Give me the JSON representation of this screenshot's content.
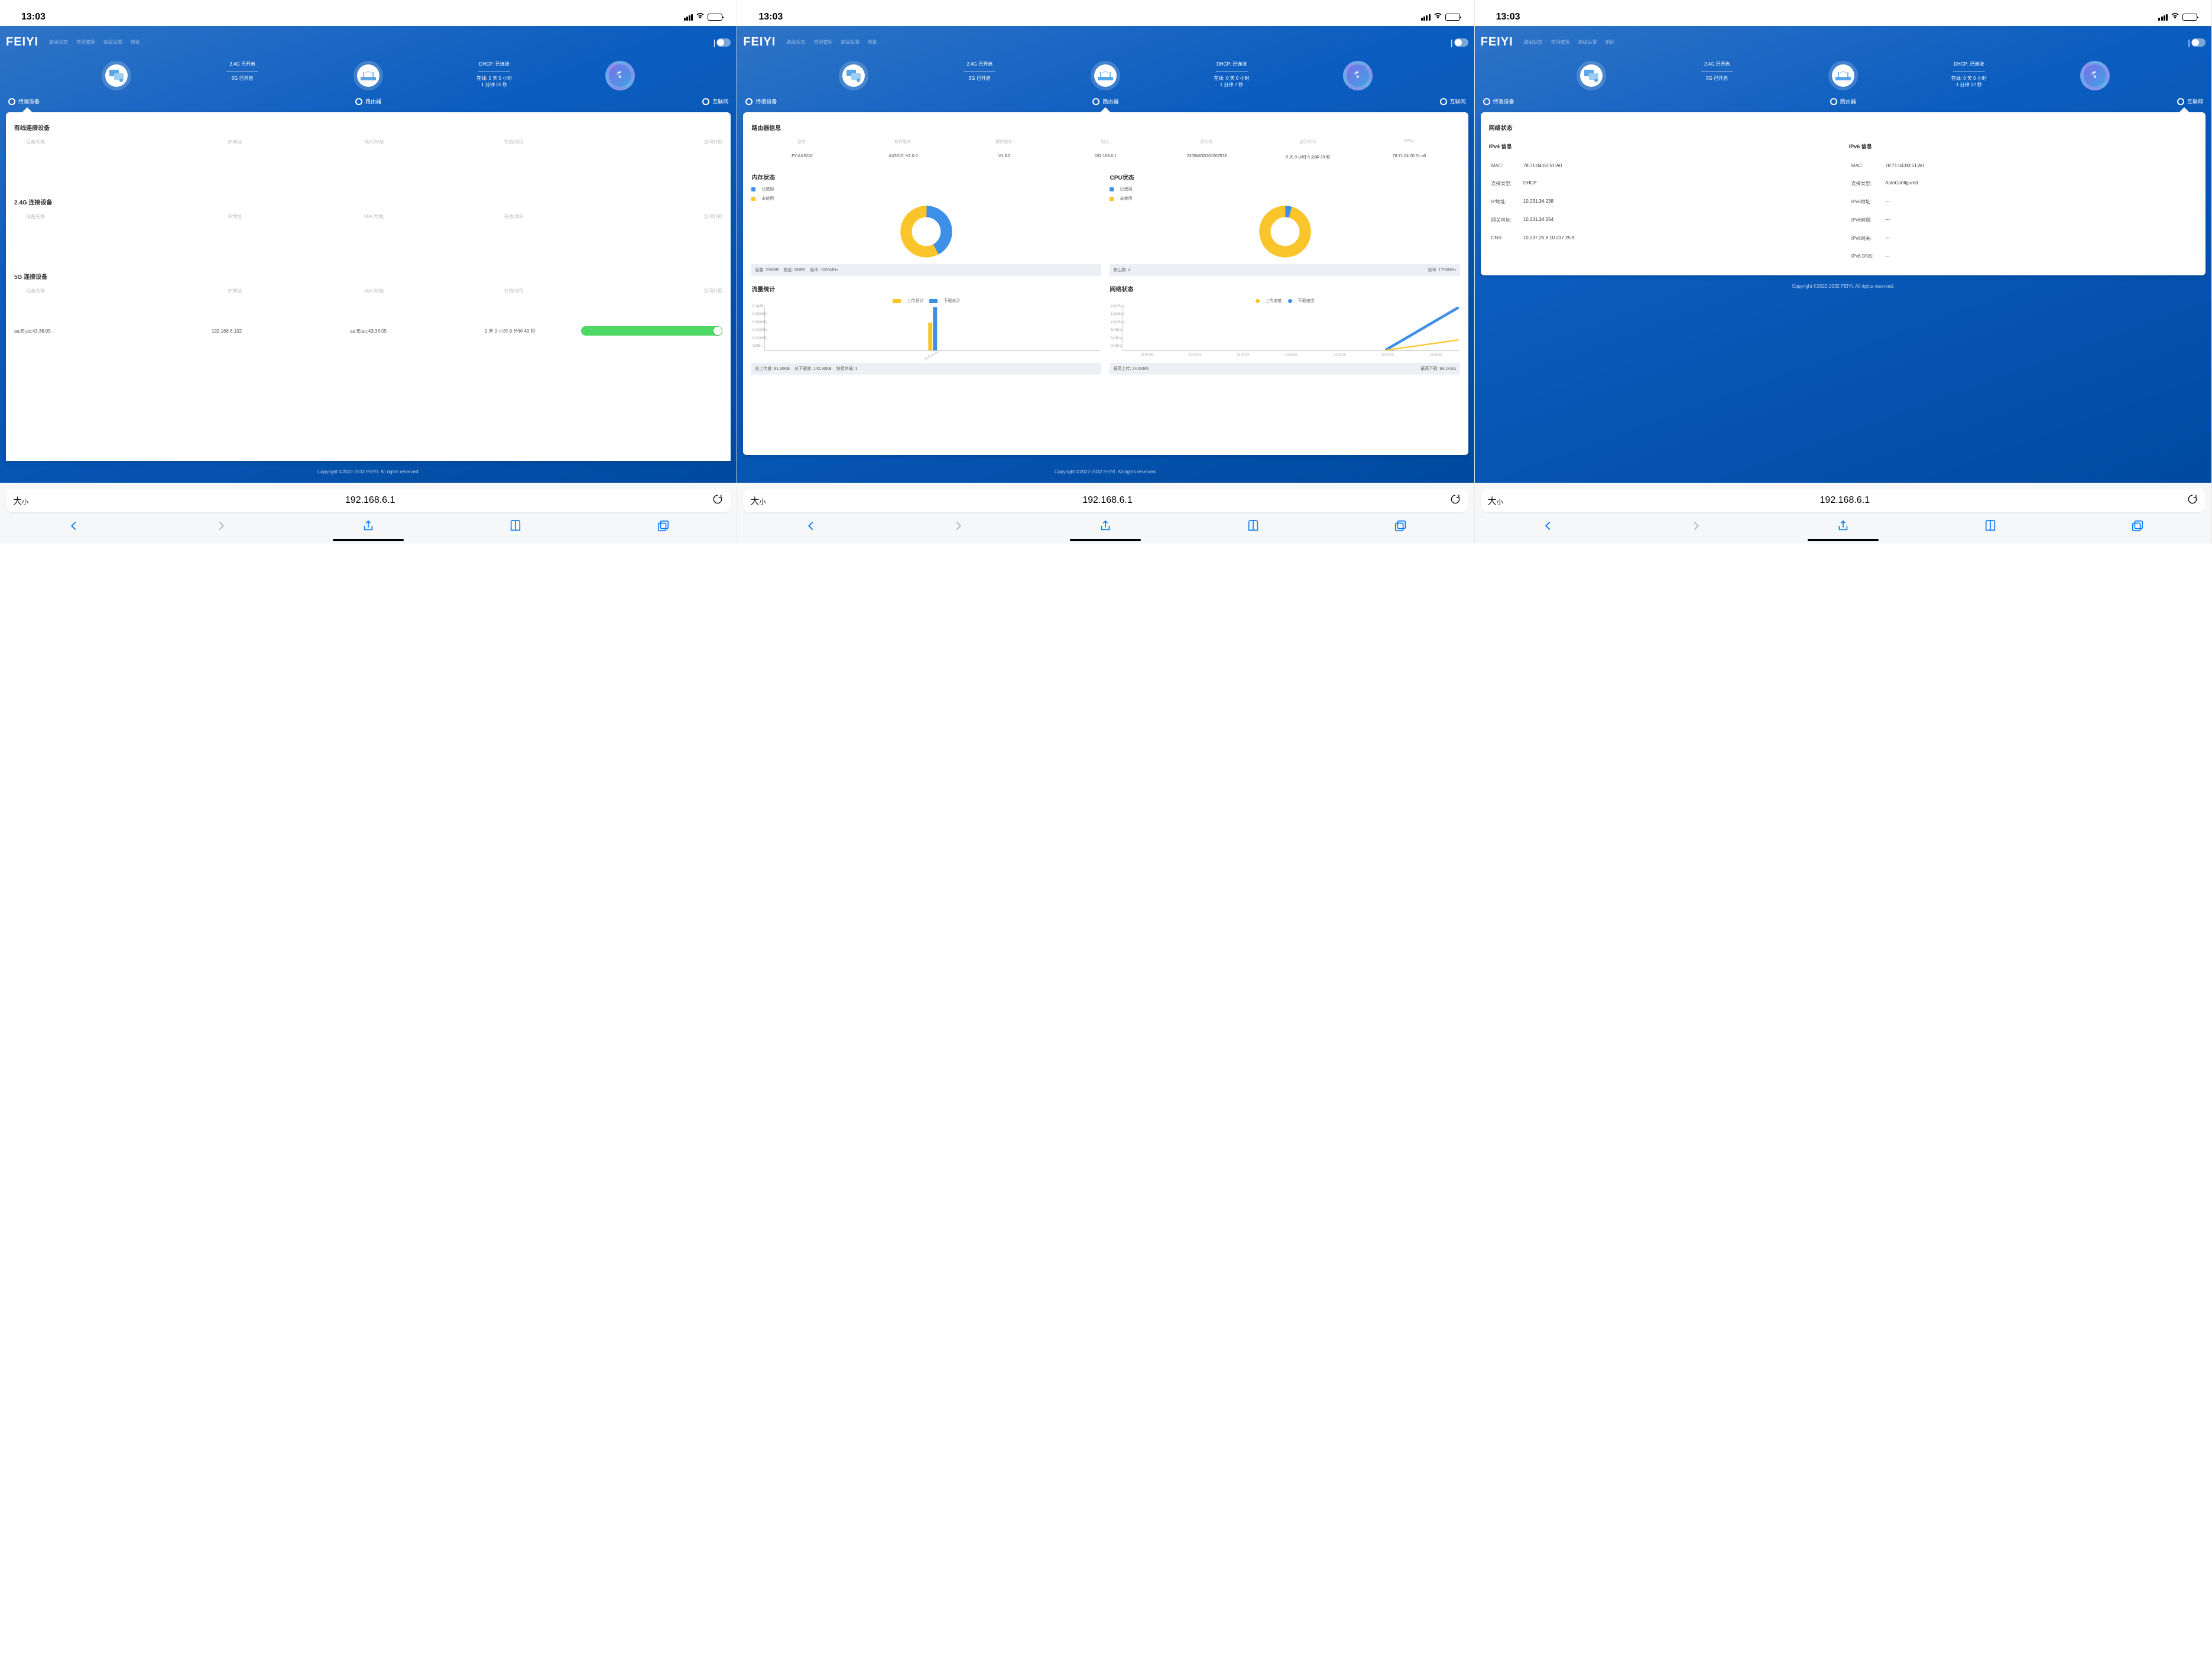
{
  "status_time": "13:03",
  "brand": "FEIYI",
  "nav": [
    "路由状态",
    "常用管理",
    "高级设置",
    "帮助"
  ],
  "hero": {
    "wifi_24": "2.4G 已开启",
    "wifi_5": "5G 已开启",
    "dhcp": "DHCP: 已连接",
    "uptime1": "在线: 0 天 0 小时 1 分钟 25 秒",
    "uptime2": "在线: 0 天 0 小时 1 分钟 7 秒",
    "uptime3": "在线: 0 天 0 小时 1 分钟 22 秒"
  },
  "cats": {
    "devices": "终端设备",
    "router": "路由器",
    "internet": "互联网"
  },
  "screen1": {
    "wired": "有线连接设备",
    "g24": "2.4G 连接设备",
    "g5": "5G 连接设备",
    "cols": [
      "设备名称",
      "IP地址",
      "MAC地址",
      "在线时间",
      "访问外网"
    ],
    "row": {
      "name": "aa:f5:ac:43:36:05",
      "ip": "192.168.6.102",
      "mac": "aa:f5:ac:43:36:05",
      "time": "0 天 0 小时 0 分钟 40 秒"
    }
  },
  "screen2": {
    "title": "路由器信息",
    "cols": [
      "型号:",
      "软件版本:",
      "硬件版本:",
      "地址:",
      "序列号:",
      "运行时间:",
      "MAC:"
    ],
    "row": [
      "FY-AX3010",
      "AX3010_V1.0.0",
      "V1.0.0",
      "192.168.6.1",
      "2205WGB261002578",
      "0 天 0 小时 6 分钟 23 秒",
      "78:71:04:00:51:a0"
    ],
    "mem": {
      "title": "内存状态",
      "used": "已使用",
      "free": "未使用",
      "info": [
        "容量: 256MB",
        "类型: DDR3",
        "频率: 1600MHz"
      ]
    },
    "cpu": {
      "title": "CPU状态",
      "used": "已使用",
      "free": "未使用",
      "info": [
        "核心数: 4",
        "频率: 1700MHz"
      ]
    },
    "traffic": {
      "title": "流量统计",
      "up": "上传总计",
      "down": "下载总计",
      "info": [
        "总上传量: 91.36KB",
        "总下载量: 142.90KB",
        "链接终端: 1"
      ],
      "ylabels": [
        "0.1(MB)",
        "0.08(MB)",
        "0.06(MB)",
        "0.04(MB)",
        "0.02(MB)",
        "0(MB)"
      ],
      "xlabel": "aa:f5:ac:43..."
    },
    "net": {
      "title": "网络状态",
      "up": "上传速度",
      "down": "下载速度",
      "info": [
        "最高上传: 24.6KB/s",
        "最高下载: 99.1KB/s"
      ],
      "ylabels": [
        "16(KB/s)",
        "12(KB/s)",
        "10(KB/s)",
        "5(KB/s)",
        "3(KB/s)",
        "0(KB/s)"
      ],
      "xlabels": [
        "13:02:48",
        "13:02:51",
        "13:02:54",
        "13:02:57",
        "13:03:00",
        "13:03:03",
        "13:03:06"
      ]
    }
  },
  "screen3": {
    "title": "网络状态",
    "ipv4_title": "IPv4 信息",
    "ipv6_title": "IPv6 信息",
    "ipv4": [
      [
        "MAC:",
        "78:71:04:00:51:A0"
      ],
      [
        "连接类型:",
        "DHCP"
      ],
      [
        "IP地址:",
        "10.231.34.238"
      ],
      [
        "网关地址:",
        "10.231.34.254"
      ],
      [
        "DNS:",
        "10.237.25.8 10.237.25.9"
      ]
    ],
    "ipv6": [
      [
        "MAC:",
        "78:71:04:00:51:A0"
      ],
      [
        "连接类型:",
        "AutoConfigured"
      ],
      [
        "IPv6地址:",
        "---"
      ],
      [
        "IPv6前缀:",
        "---"
      ],
      [
        "IPv6网关:",
        "---"
      ],
      [
        "IPv6 DNS:",
        "---"
      ]
    ]
  },
  "copyright": "Copyright ©2022-2032 FEIYI. All rights reserved.",
  "url": "192.168.6.1",
  "aa": "大",
  "aa_sm": "小",
  "chart_data": [
    {
      "type": "pie",
      "title": "内存状态",
      "series": [
        {
          "name": "已使用",
          "value": 42
        },
        {
          "name": "未使用",
          "value": 58
        }
      ]
    },
    {
      "type": "pie",
      "title": "CPU状态",
      "series": [
        {
          "name": "已使用",
          "value": 4
        },
        {
          "name": "未使用",
          "value": 96
        }
      ]
    },
    {
      "type": "bar",
      "title": "流量统计",
      "categories": [
        "aa:f5:ac:43..."
      ],
      "series": [
        {
          "name": "上传总计",
          "values": [
            0.09
          ]
        },
        {
          "name": "下载总计",
          "values": [
            0.14
          ]
        }
      ],
      "ylabel": "MB",
      "ylim": [
        0,
        0.1
      ]
    },
    {
      "type": "line",
      "title": "网络状态",
      "x": [
        "13:02:48",
        "13:02:51",
        "13:02:54",
        "13:02:57",
        "13:03:00",
        "13:03:03",
        "13:03:06"
      ],
      "series": [
        {
          "name": "上传速度",
          "values": [
            0,
            0,
            0,
            0,
            0,
            0,
            4
          ]
        },
        {
          "name": "下载速度",
          "values": [
            0,
            0,
            0,
            0,
            0,
            0,
            16
          ]
        }
      ],
      "ylabel": "KB/s",
      "ylim": [
        0,
        16
      ]
    }
  ]
}
